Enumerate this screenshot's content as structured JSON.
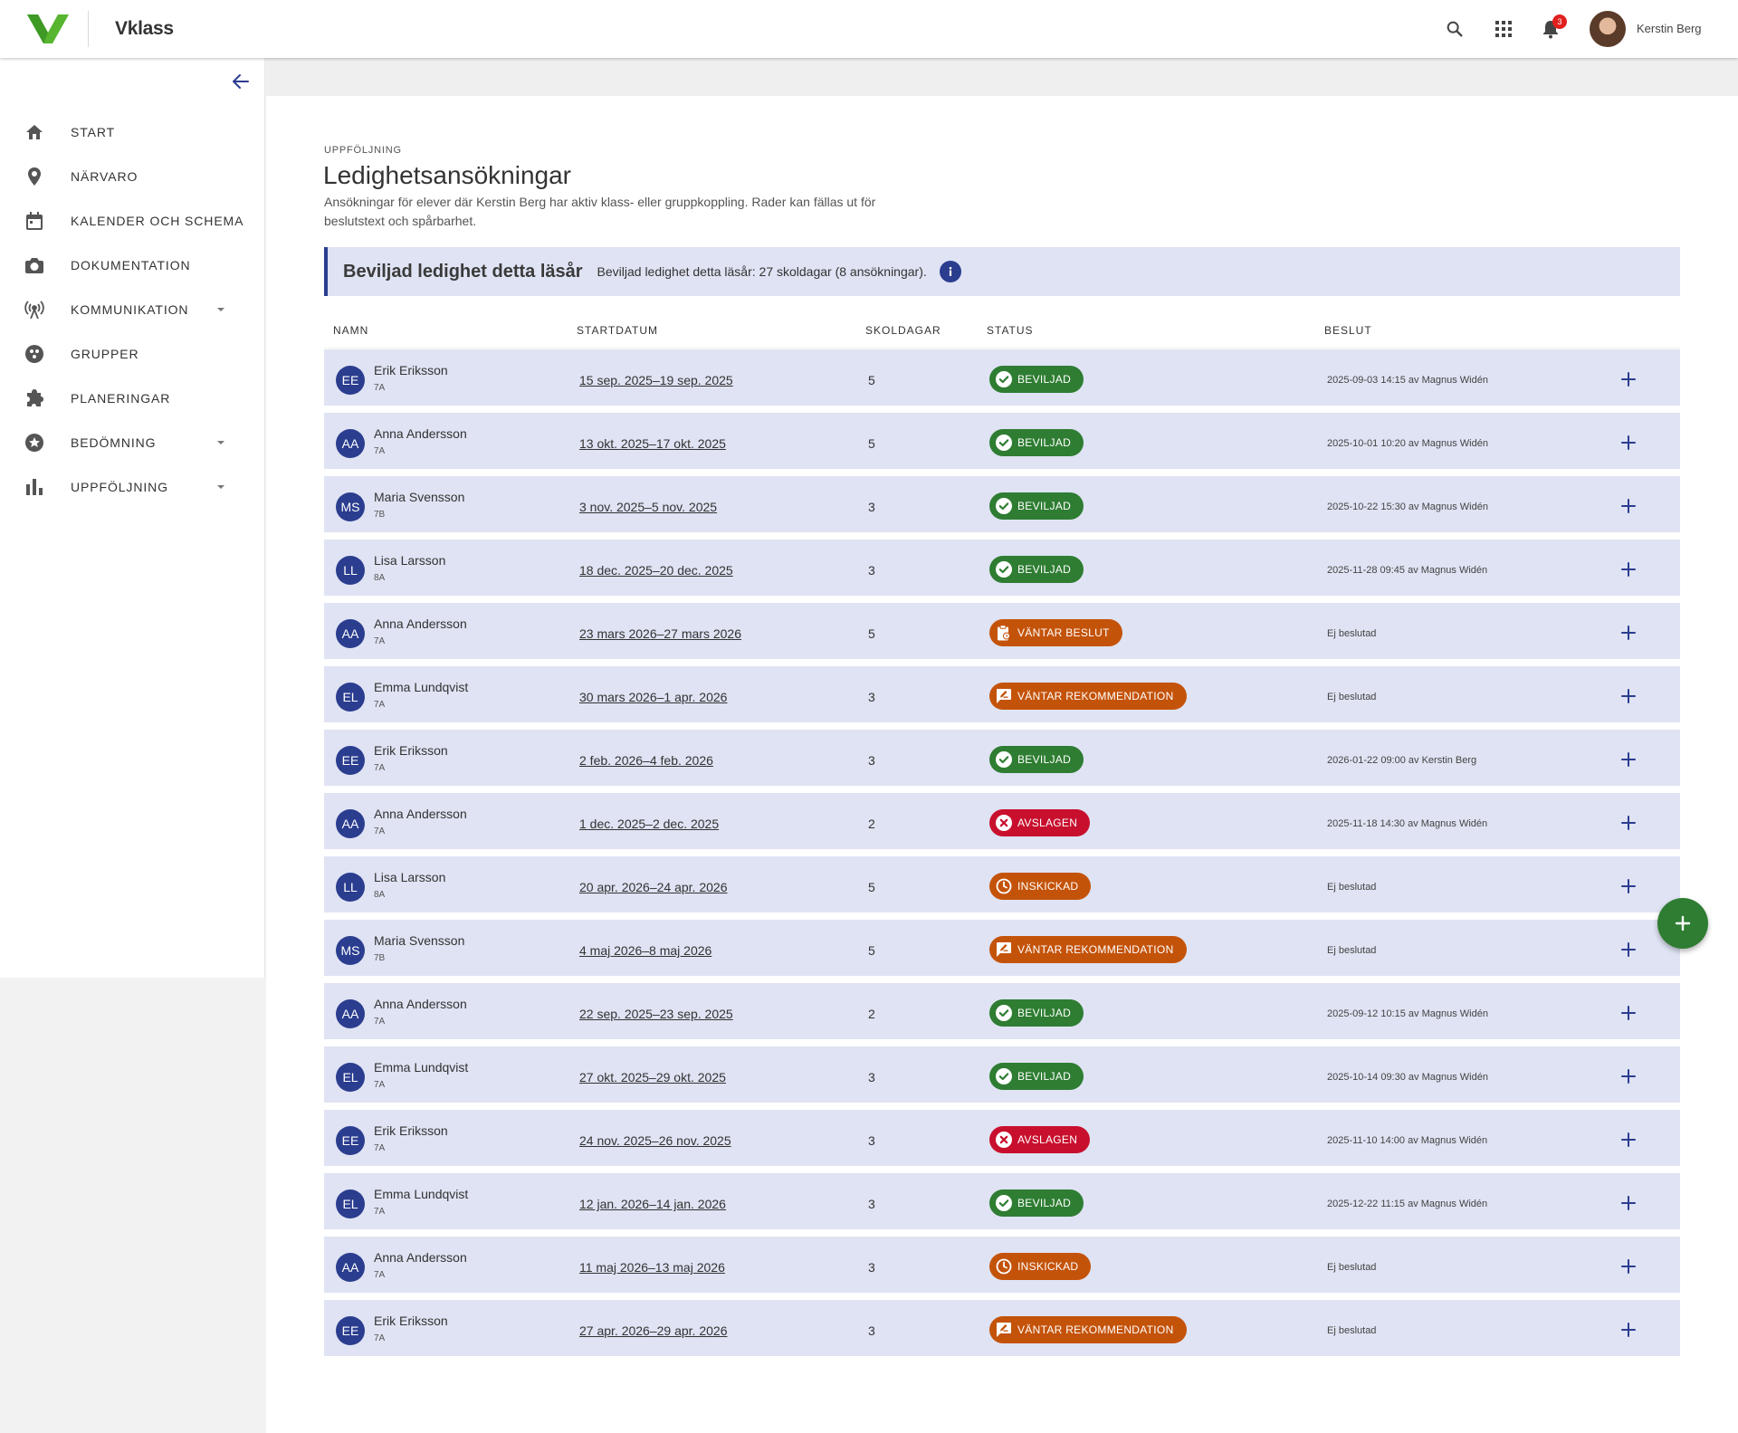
{
  "header": {
    "brand": "Vklass",
    "notification_count": "3",
    "user_name": "Kerstin Berg"
  },
  "sidebar": {
    "items": [
      {
        "label": "START",
        "icon": "home-icon",
        "has_caret": false
      },
      {
        "label": "NÄRVARO",
        "icon": "location-pin-icon",
        "has_caret": false
      },
      {
        "label": "KALENDER OCH SCHEMA",
        "icon": "calendar-icon",
        "has_caret": false
      },
      {
        "label": "DOKUMENTATION",
        "icon": "camera-icon",
        "has_caret": false
      },
      {
        "label": "KOMMUNIKATION",
        "icon": "broadcast-icon",
        "has_caret": true
      },
      {
        "label": "GRUPPER",
        "icon": "group-icon",
        "has_caret": false
      },
      {
        "label": "PLANERINGAR",
        "icon": "puzzle-icon",
        "has_caret": false
      },
      {
        "label": "BEDÖMNING",
        "icon": "star-badge-icon",
        "has_caret": true
      },
      {
        "label": "UPPFÖLJNING",
        "icon": "bar-chart-icon",
        "has_caret": true
      }
    ]
  },
  "main": {
    "breadcrumb": "UPPFÖLJNING",
    "title": "Ledighetsansökningar",
    "description": "Ansökningar för elever där Kerstin Berg har aktiv klass- eller gruppkoppling. Rader kan fällas ut för beslutstext och spårbarhet.",
    "summary": {
      "title": "Beviljad ledighet detta läsår",
      "text": "Beviljad ledighet detta läsår: 27 skoldagar (8 ansökningar)."
    },
    "table": {
      "headers": [
        "NAMN",
        "STARTDATUM",
        "SKOLDAGAR",
        "STATUS",
        "BESLUT"
      ],
      "rows": [
        {
          "initials": "EE",
          "name": "Erik Eriksson",
          "class": "7A",
          "dates": "15 sep. 2025–19 sep. 2025",
          "days": "5",
          "status": "BEVILJAD",
          "status_type": "approved",
          "decision": "2025-09-03 14:15 av Magnus Widén"
        },
        {
          "initials": "AA",
          "name": "Anna Andersson",
          "class": "7A",
          "dates": "13 okt. 2025–17 okt. 2025",
          "days": "5",
          "status": "BEVILJAD",
          "status_type": "approved",
          "decision": "2025-10-01 10:20 av Magnus Widén"
        },
        {
          "initials": "MS",
          "name": "Maria Svensson",
          "class": "7B",
          "dates": "3 nov. 2025–5 nov. 2025",
          "days": "3",
          "status": "BEVILJAD",
          "status_type": "approved",
          "decision": "2025-10-22 15:30 av Magnus Widén"
        },
        {
          "initials": "LL",
          "name": "Lisa Larsson",
          "class": "8A",
          "dates": "18 dec. 2025–20 dec. 2025",
          "days": "3",
          "status": "BEVILJAD",
          "status_type": "approved",
          "decision": "2025-11-28 09:45 av Magnus Widén"
        },
        {
          "initials": "AA",
          "name": "Anna Andersson",
          "class": "7A",
          "dates": "23 mars 2026–27 mars 2026",
          "days": "5",
          "status": "VÄNTAR BESLUT",
          "status_type": "awaiting-decision",
          "decision": "Ej beslutad"
        },
        {
          "initials": "EL",
          "name": "Emma Lundqvist",
          "class": "7A",
          "dates": "30 mars 2026–1 apr. 2026",
          "days": "3",
          "status": "VÄNTAR REKOMMENDATION",
          "status_type": "awaiting-recommendation",
          "decision": "Ej beslutad"
        },
        {
          "initials": "EE",
          "name": "Erik Eriksson",
          "class": "7A",
          "dates": "2 feb. 2026–4 feb. 2026",
          "days": "3",
          "status": "BEVILJAD",
          "status_type": "approved",
          "decision": "2026-01-22 09:00 av Kerstin Berg"
        },
        {
          "initials": "AA",
          "name": "Anna Andersson",
          "class": "7A",
          "dates": "1 dec. 2025–2 dec. 2025",
          "days": "2",
          "status": "AVSLAGEN",
          "status_type": "rejected",
          "decision": "2025-11-18 14:30 av Magnus Widén"
        },
        {
          "initials": "LL",
          "name": "Lisa Larsson",
          "class": "8A",
          "dates": "20 apr. 2026–24 apr. 2026",
          "days": "5",
          "status": "INSKICKAD",
          "status_type": "submitted",
          "decision": "Ej beslutad"
        },
        {
          "initials": "MS",
          "name": "Maria Svensson",
          "class": "7B",
          "dates": "4 maj 2026–8 maj 2026",
          "days": "5",
          "status": "VÄNTAR REKOMMENDATION",
          "status_type": "awaiting-recommendation",
          "decision": "Ej beslutad"
        },
        {
          "initials": "AA",
          "name": "Anna Andersson",
          "class": "7A",
          "dates": "22 sep. 2025–23 sep. 2025",
          "days": "2",
          "status": "BEVILJAD",
          "status_type": "approved",
          "decision": "2025-09-12 10:15 av Magnus Widén"
        },
        {
          "initials": "EL",
          "name": "Emma Lundqvist",
          "class": "7A",
          "dates": "27 okt. 2025–29 okt. 2025",
          "days": "3",
          "status": "BEVILJAD",
          "status_type": "approved",
          "decision": "2025-10-14 09:30 av Magnus Widén"
        },
        {
          "initials": "EE",
          "name": "Erik Eriksson",
          "class": "7A",
          "dates": "24 nov. 2025–26 nov. 2025",
          "days": "3",
          "status": "AVSLAGEN",
          "status_type": "rejected",
          "decision": "2025-11-10 14:00 av Magnus Widén"
        },
        {
          "initials": "EL",
          "name": "Emma Lundqvist",
          "class": "7A",
          "dates": "12 jan. 2026–14 jan. 2026",
          "days": "3",
          "status": "BEVILJAD",
          "status_type": "approved",
          "decision": "2025-12-22 11:15 av Magnus Widén"
        },
        {
          "initials": "AA",
          "name": "Anna Andersson",
          "class": "7A",
          "dates": "11 maj 2026–13 maj 2026",
          "days": "3",
          "status": "INSKICKAD",
          "status_type": "submitted",
          "decision": "Ej beslutad"
        },
        {
          "initials": "EE",
          "name": "Erik Eriksson",
          "class": "7A",
          "dates": "27 apr. 2026–29 apr. 2026",
          "days": "3",
          "status": "VÄNTAR REKOMMENDATION",
          "status_type": "awaiting-recommendation",
          "decision": "Ej beslutad"
        }
      ]
    }
  },
  "colors": {
    "brand_primary": "#2b3d8f",
    "approved": "#2e7d32",
    "pending": "#c4530a",
    "rejected": "#c8102e",
    "row_background": "#dfe3f3"
  }
}
